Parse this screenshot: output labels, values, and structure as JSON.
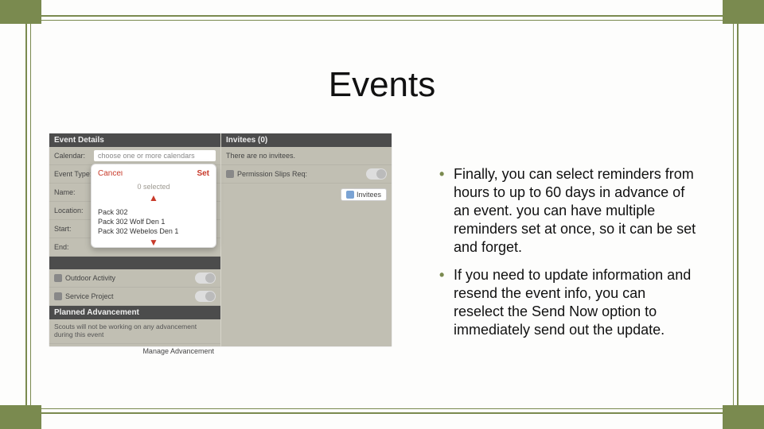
{
  "title": "Events",
  "bullets": [
    "Finally, you can select reminders from hours to up to 60 days in advance of an event.  you can have multiple reminders set at once, so it can be set and forget.",
    "If you need to update information and resend the event info, you can reselect the Send Now option to immediately send out the update."
  ],
  "shot": {
    "leftHeader": "Event Details",
    "rightHeader": "Invitees (0)",
    "labels": {
      "calendar": "Calendar:",
      "eventType": "Event Type:",
      "name": "Name:",
      "location": "Location:",
      "start": "Start:",
      "end": "End:"
    },
    "calendarPlaceholder": "choose one or more calendars",
    "invitesLine": "There are no invitees.",
    "permSlips": "Permission Slips Req:",
    "invitesBtn": "Invitees",
    "plannedHeader": "Planned Advancement",
    "plannedNote": "Scouts will not be working on any advancement during this event",
    "manage": "Manage Advancement",
    "otherToggles": [
      "Outdoor Activity",
      "Service Project"
    ],
    "dividerHeader": "",
    "popup": {
      "cancel": "Cancel",
      "set": "Set",
      "selected": "0 selected",
      "arrowUp": "▲",
      "arrowDown": "▼",
      "items": [
        "Pack 302",
        "Pack 302 Wolf Den 1",
        "Pack 302 Webelos Den 1"
      ]
    }
  }
}
